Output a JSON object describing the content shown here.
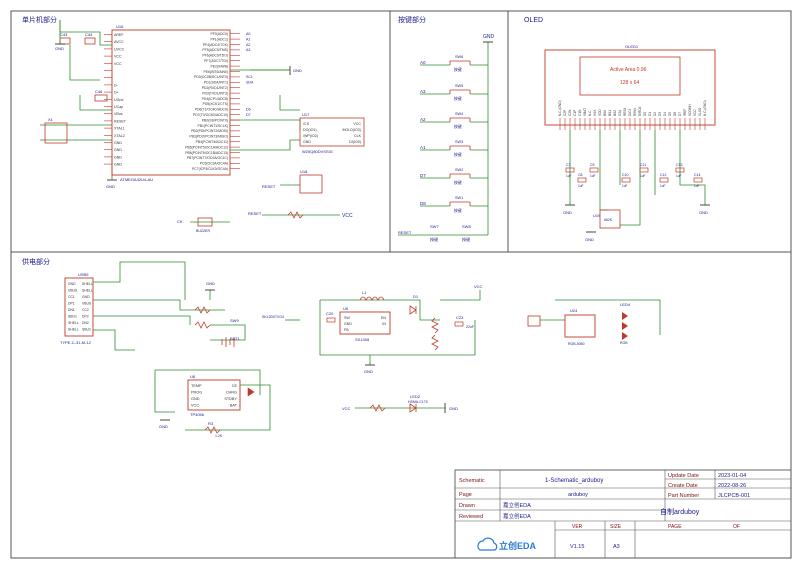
{
  "sections": {
    "mcu": "单片机部分",
    "keys": "按键部分",
    "oled": "OLED",
    "power": "供电部分"
  },
  "colors": {
    "wire": "#2e8b2e",
    "part": "#c0392b",
    "frame": "#555555",
    "text": "#1a1a8c",
    "pin_text": "#333333",
    "gnd_text": "#1a1a8c",
    "title_text": "#7a1010",
    "logo": "#2b7bd6"
  },
  "mcu": {
    "chip_ref": "U16",
    "chip_name": "ATMEGA32U4-AU",
    "left_pins": [
      "AREF",
      "AVCC",
      "UVCC",
      "VCC",
      "VCC",
      "",
      "",
      "D-",
      "D+",
      "UGnd",
      "UCap",
      "VBus",
      "RESET",
      "XTAL1",
      "XTAL2",
      "GND",
      "GND",
      "GND",
      "GND"
    ],
    "right_pins": [
      "PF0(ADC0)",
      "PF1(ADC1)",
      "PF4(ADC4/TCK)",
      "PF5(ADC5/TMS)",
      "PF6(ADC6/TDO)",
      "PF7(ADC7/TDI)",
      "PE2(/HWB)",
      "PE6(INT6/AIN0)",
      "PD0(OC0B/SCL/INT0)",
      "PD1(SDA/INT1)",
      "PD2(RXD1/INT2)",
      "PD3(TXD1/INT3)",
      "PD4(ICP1/ADC8)",
      "PD5(XCK1/CTS)",
      "PD6(T1/OC4D/ADC9)",
      "PD7(T0/OC4D/ADC10)",
      "PB0(SS/PCINT0)",
      "PB1(PCINT1/SCLK)",
      "PB2(PDI/PCINT2/MOSI)",
      "PB3(PDO/PCINT3/MISO)",
      "PB4(PCINT4/ADC11)",
      "PB5(PCINT5/OC1A/ADC12)",
      "PB6(PCINT6/OC1B/ADC13)",
      "PB7(PCINT7/OC0A/OC1C)",
      "PC6(OC3A/OC4A)",
      "PC7(ICP3/CLK0/OC4A)"
    ],
    "right_nets": [
      "A0",
      "A1",
      "A2",
      "A3",
      "",
      "",
      "",
      "",
      "SCL",
      "SDA",
      "",
      "",
      "",
      "",
      "D6",
      "D7",
      "",
      "",
      "",
      "",
      "",
      "",
      "",
      "",
      "",
      ""
    ],
    "flash_ref": "U17",
    "flash_name": "W25Q80DVSSIG",
    "flash_left": [
      "/CS",
      "DO(IO1)",
      "/WP(IO2)",
      "GND"
    ],
    "flash_right": [
      "VCC",
      "/HOLD(IO3)",
      "CLK",
      "DI(IO0)"
    ],
    "reset_ref": "U18",
    "reset_name": "RESET",
    "gnd": "GND",
    "vcc": "VCC",
    "d_label": "D+",
    "cap_labels": [
      "C1",
      "C2",
      "C3",
      "C4",
      "C5",
      "C6",
      "C43",
      "C44",
      "C46"
    ],
    "small_labels": [
      "R18",
      "R19",
      "R20",
      "R22",
      "X1"
    ],
    "ck_label": "CK",
    "buzzer_label": "BUZZER"
  },
  "keys": {
    "nets": [
      "A0",
      "A3",
      "A2",
      "A1",
      "D7",
      "D8"
    ],
    "switch_refs": [
      "SW6",
      "SW5",
      "SW4",
      "SW3",
      "SW2",
      "SW1"
    ],
    "switch_name": "按键",
    "reset_net": "RESET",
    "bottom_refs": [
      "SW7",
      "SW8"
    ],
    "gnd": "GND"
  },
  "oled": {
    "ref": "OLED1",
    "active_area": "Active Area  0.96",
    "resolution": "128 x 64",
    "pins": [
      "N.C.(GND)",
      "C2P",
      "C2N",
      "C1P",
      "C1N",
      "VBAT",
      "N.C.",
      "VSS",
      "VDD",
      "BS0",
      "BS1",
      "BS2",
      "CS#",
      "RES#",
      "D/C#",
      "R/W#",
      "E/RD#",
      "D0",
      "D1",
      "D2",
      "D3",
      "D4",
      "D5",
      "D6",
      "D7",
      "IREF",
      "VCOMH",
      "VCC",
      "VLSS",
      "N.C.(GND)"
    ],
    "reg_ref": "U19",
    "reg_name": "662K",
    "caps": [
      "C7",
      "C8",
      "C9",
      "C10",
      "C11",
      "C12",
      "C13",
      "C14"
    ],
    "cap_value": "1uF",
    "gnd": "GND"
  },
  "power": {
    "usb_ref": "USB5",
    "usb_name": "TYPE-C-31-M-12",
    "usb_pins": [
      "GND",
      "VBUS",
      "CC1",
      "DP1",
      "DN1",
      "SBU1",
      "SHELL",
      "SHELL",
      "SHELL",
      "SHELL",
      "GND",
      "VBUS",
      "CC2",
      "DP2",
      "DN2",
      "SBU2"
    ],
    "charger_ref": "U8",
    "charger_name": "TP4056",
    "charger_left": [
      "TEMP",
      "PROG",
      "GND",
      "VCC"
    ],
    "charger_right": [
      "CE",
      "CHRG",
      "STDBY",
      "BAT"
    ],
    "boost_ref": "U6",
    "boost_name": "SX1308",
    "boost_pins": [
      "SW",
      "GND",
      "FB",
      "EN",
      "IN"
    ],
    "inductor": "L1",
    "inductor_value": "22uH",
    "diode_ref": "D1",
    "diode_name": "SS34",
    "switch_ref": "SW9",
    "switch_name": "SK12D07VG4",
    "battery_ref": "BAT1",
    "resistor_refs": [
      "R1",
      "R2",
      "R3",
      "R4",
      "R5",
      "R6",
      "R7",
      "R8",
      "R9",
      "R10",
      "R11",
      "R12",
      "R21"
    ],
    "led_refs": [
      "LED1",
      "LED2",
      "LED3",
      "LED4"
    ],
    "led_names": [
      "RGB",
      "HSMA-C170"
    ],
    "rgb_ref": "U24",
    "rgb_name": "RGB-5050",
    "res_values": [
      "1.2K",
      "10K",
      "100K",
      "1K",
      "5.1K"
    ],
    "cap_labels": [
      "C20",
      "C21",
      "C22",
      "C23"
    ],
    "cap_value": "22uF",
    "gnd": "GND",
    "vcc": "VCC"
  },
  "title_block": {
    "schematic_label": "Schematic",
    "schematic_value": "1-Schematic_arduboy",
    "page_label": "Page",
    "page_value": "arduboy",
    "drawn_label": "Drawn",
    "drawn_value": "嘉立创EDA",
    "reviewed_label": "Reviewed",
    "reviewed_value": "嘉立创EDA",
    "update_label": "Update Date",
    "update_value": "2023-01-04",
    "create_label": "Create Date",
    "create_value": "2022-08-26",
    "part_label": "Part Number",
    "part_value": "JLCPCB-001",
    "project_title": "自制arduboy",
    "ver_label": "VER",
    "ver_value": "V1.15",
    "size_label": "SIZE",
    "size_value": "A3",
    "page_no_label": "PAGE",
    "of_label": "OF",
    "logo_text": "立创EDA"
  }
}
